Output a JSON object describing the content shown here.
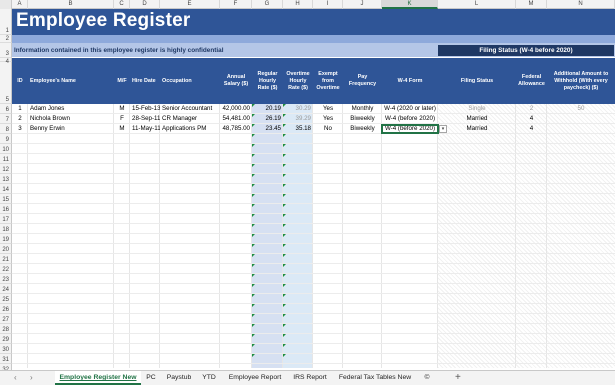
{
  "columns": [
    "A",
    "B",
    "C",
    "D",
    "E",
    "F",
    "G",
    "H",
    "I",
    "J",
    "K",
    "L",
    "M",
    "N"
  ],
  "selected_column": "K",
  "rows": [
    "1",
    "2",
    "3",
    "4",
    "5",
    "6",
    "7",
    "8",
    "9",
    "10",
    "11",
    "12",
    "13",
    "14",
    "15",
    "16",
    "17",
    "18",
    "19",
    "20",
    "21",
    "22",
    "23",
    "24",
    "25",
    "26",
    "27",
    "28",
    "29",
    "30",
    "31",
    "32"
  ],
  "title": "Employee Register",
  "confidential": "Information contained in this employee register is highly confidential",
  "filing_status_box": "Filing Status (W-4 before 2020)",
  "headers": {
    "id": "ID",
    "name": "Employee's Name",
    "mf": "M/F",
    "hire": "Hire Date",
    "occupation": "Occupation",
    "salary": "Annual Salary ($)",
    "regular": "Regular Hourly Rate ($)",
    "overtime": "Overtime Hourly Rate ($)",
    "exempt": "Exempt from Overtime",
    "pay": "Pay Frequency",
    "w4": "W-4 Form",
    "filing": "Filing Status",
    "allowance": "Federal Allowance",
    "additional": "Additional Amount to Withhold (With every paycheck) ($)"
  },
  "employees": [
    {
      "id": "1",
      "name": "Adam Jones",
      "mf": "M",
      "hire": "15-Feb-13",
      "occupation": "Senior Accountant",
      "salary": "42,000.00",
      "regular": "20.19",
      "overtime": "30.29",
      "exempt": "Yes",
      "pay": "Monthly",
      "w4": "W-4 (2020 or later)",
      "filing": "Single",
      "allowance": "2",
      "additional": "50"
    },
    {
      "id": "2",
      "name": "Nichola Brown",
      "mf": "F",
      "hire": "28-Sep-11",
      "occupation": "CR Manager",
      "salary": "54,481.00",
      "regular": "26.19",
      "overtime": "39.29",
      "exempt": "Yes",
      "pay": "Biweekly",
      "w4": "W-4 (before 2020)",
      "filing": "Married",
      "allowance": "4",
      "additional": ""
    },
    {
      "id": "3",
      "name": "Benny Erwin",
      "mf": "M",
      "hire": "11-May-11",
      "occupation": "Applications PM",
      "salary": "48,785.00",
      "regular": "23.45",
      "overtime": "35.18",
      "exempt": "No",
      "pay": "Biweekly",
      "w4": "W-4 (before 2020)",
      "filing": "Married",
      "allowance": "4",
      "additional": ""
    }
  ],
  "dropdown_glyph": "▾",
  "tabs": [
    "Employee Register New",
    "PC",
    "Paystub",
    "YTD",
    "Employee Report",
    "IRS Report",
    "Federal Tax Tables New",
    "©"
  ],
  "active_tab": "Employee Register New",
  "add_sheet": "+",
  "nav_prev": "‹",
  "nav_next": "›",
  "colors": {
    "banner": "#2f5597",
    "band": "#8ea9db",
    "accent": "#217346"
  }
}
